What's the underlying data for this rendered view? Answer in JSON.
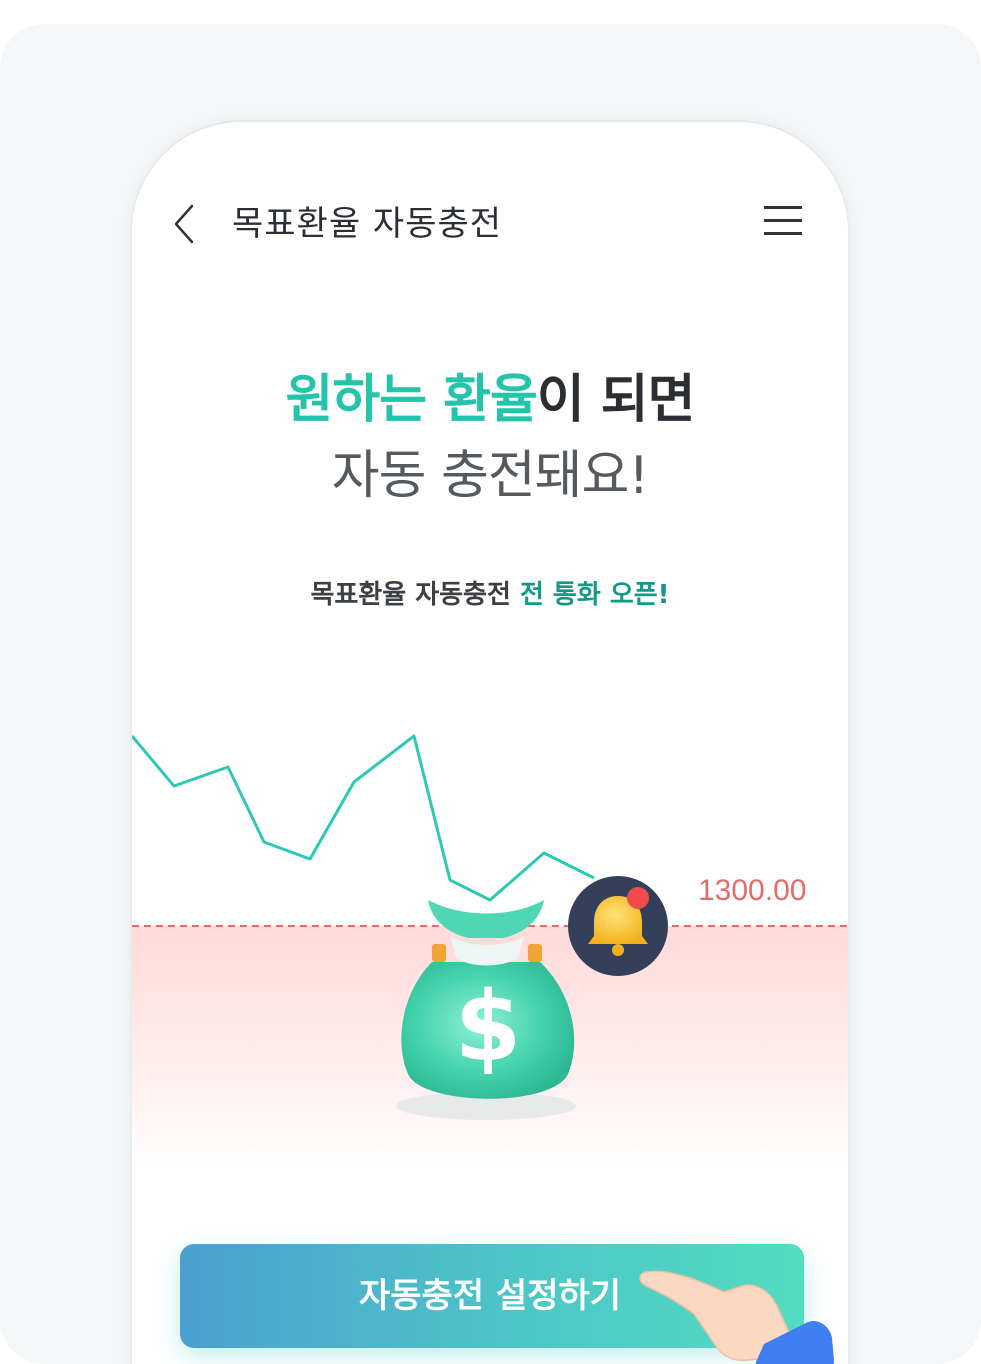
{
  "header": {
    "title": "목표환율 자동충전",
    "back_icon": "chevron-left-icon",
    "menu_icon": "hamburger-menu-icon"
  },
  "hero": {
    "line1_accent": "원하는 환율",
    "line1_rest": "이 되면",
    "line2": "자동 충전돼요!"
  },
  "subtitle": {
    "prefix": "목표환율 자동충전 ",
    "accent": "전 통화 오픈!"
  },
  "chart": {
    "target_rate_label": "1300.00",
    "line_color": "#2ec8b4",
    "target_color": "#e66a6a"
  },
  "illustration": {
    "money_bag_icon": "money-bag-icon",
    "bell_icon": "bell-icon",
    "hand_icon": "pointing-hand-icon"
  },
  "cta": {
    "label": "자동충전 설정하기"
  },
  "colors": {
    "accent": "#23c4aa",
    "accent_dark": "#12998a",
    "button_start": "#4ba0cf",
    "button_end": "#52dcc0"
  }
}
